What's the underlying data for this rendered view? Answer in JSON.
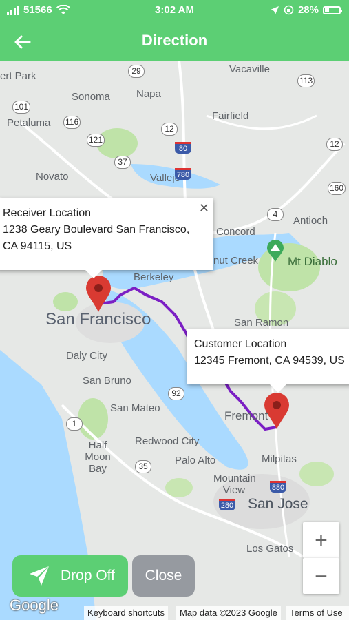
{
  "status_bar": {
    "carrier": "51566",
    "time": "3:02 AM",
    "battery": "28%",
    "battery_level": 0.28
  },
  "header": {
    "title": "Direction",
    "back_icon": "arrow-left-icon"
  },
  "map": {
    "labels": [
      "ert Park",
      "Sonoma",
      "Napa",
      "Vacaville",
      "Petaluma",
      "Fairfield",
      "Novato",
      "Vallejo",
      "Concord",
      "Antioch",
      "nut Creek",
      "Mt Diablo",
      "Berkeley",
      "San Francisco",
      "San Ramon",
      "Daly City",
      "San Bruno",
      "San Mateo",
      "Fremont",
      "Half Moon Bay",
      "Redwood City",
      "Palo Alto",
      "Mountain View",
      "Milpitas",
      "San Jose",
      "Los Gatos"
    ],
    "route_color": "#7b1fc4",
    "marker_color": "#d93a32"
  },
  "receiver_info": {
    "title": "Receiver Location",
    "line1": "1238 Geary Boulevard San Francisco,",
    "line2": "CA 94115, US"
  },
  "customer_info": {
    "title": "Customer Location",
    "line1": "12345 Fremont, CA 94539, US"
  },
  "zoom": {
    "in_label": "+",
    "out_label": "−"
  },
  "actions": {
    "dropoff_label": "Drop Off",
    "close_label": "Close"
  },
  "attribution": {
    "logo": "Google",
    "keyboard": "Keyboard shortcuts",
    "map_data": "Map data ©2023 Google",
    "terms": "Terms of Use"
  },
  "colors": {
    "accent": "#5ccf74",
    "close_button": "#969aa0",
    "water": "#aadaff"
  }
}
